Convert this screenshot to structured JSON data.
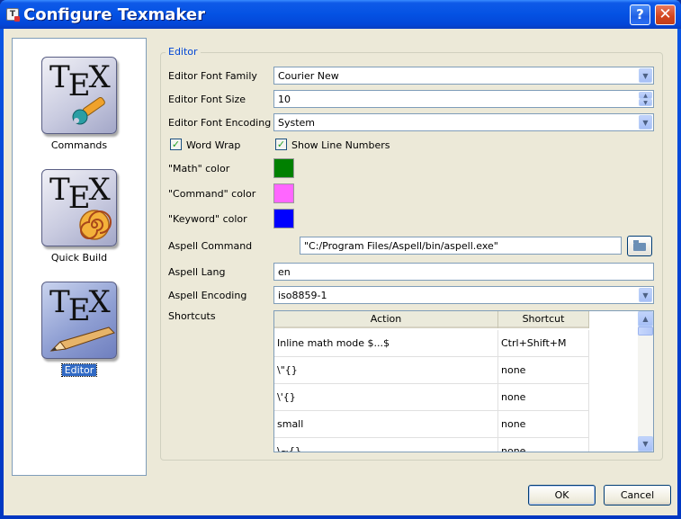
{
  "window": {
    "title": "Configure Texmaker",
    "help_glyph": "?",
    "close_glyph": "✕"
  },
  "sidebar": {
    "items": [
      {
        "label": "Commands",
        "icon": "tex-wrench-icon"
      },
      {
        "label": "Quick Build",
        "icon": "tex-spiral-icon"
      },
      {
        "label": "Editor",
        "icon": "tex-pencil-icon",
        "selected": true
      }
    ]
  },
  "editor": {
    "group_title": "Editor",
    "font_family_label": "Editor Font Family",
    "font_family_value": "Courier New",
    "font_size_label": "Editor Font Size",
    "font_size_value": "10",
    "font_encoding_label": "Editor Font Encoding",
    "font_encoding_value": "System",
    "word_wrap_label": "Word Wrap",
    "word_wrap_checked": true,
    "line_numbers_label": "Show Line Numbers",
    "line_numbers_checked": true,
    "math_color_label": "\"Math\" color",
    "math_color": "#008000",
    "command_color_label": "\"Command\" color",
    "command_color": "#ff66ff",
    "keyword_color_label": "\"Keyword\" color",
    "keyword_color": "#0000ff",
    "aspell_command_label": "Aspell Command",
    "aspell_command_value": "\"C:/Program Files/Aspell/bin/aspell.exe\"",
    "aspell_lang_label": "Aspell Lang",
    "aspell_lang_value": "en",
    "aspell_encoding_label": "Aspell Encoding",
    "aspell_encoding_value": "iso8859-1",
    "shortcuts_label": "Shortcuts"
  },
  "shortcuts_table": {
    "columns": [
      "Action",
      "Shortcut"
    ],
    "rows": [
      {
        "action": "Inline math mode $...$",
        "shortcut": "Ctrl+Shift+M"
      },
      {
        "action": "\\\"{}",
        "shortcut": "none"
      },
      {
        "action": "\\'{}",
        "shortcut": "none"
      },
      {
        "action": "small",
        "shortcut": "none"
      },
      {
        "action": "\\~{}",
        "shortcut": "none"
      }
    ]
  },
  "buttons": {
    "ok": "OK",
    "cancel": "Cancel"
  },
  "colors": {
    "title_bar": "#0452e3",
    "dialog_bg": "#ece9d8",
    "selection": "#316ac5",
    "group_title": "#0046d5"
  }
}
